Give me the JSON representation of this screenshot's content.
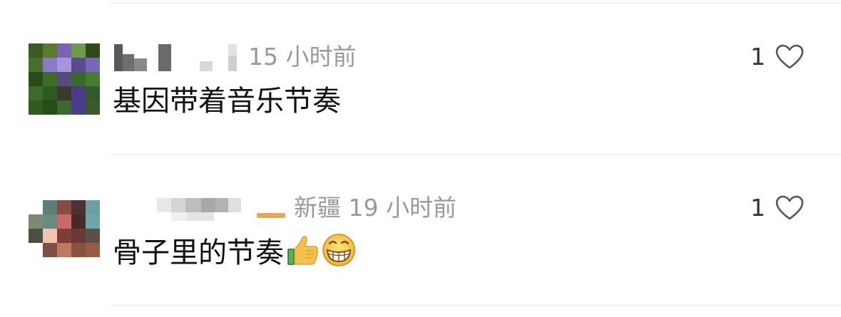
{
  "comments": [
    {
      "location": "",
      "time": "15 小时前",
      "text": "基因带着音乐节奏",
      "likes": "1",
      "avatar_colors": [
        "#3d5a1f",
        "#5a7a2c",
        "#7b62b5",
        "#6f9a4a",
        "#2f4a18",
        "#4b6f2a",
        "#8b79c9",
        "#a895dc",
        "#5c4a8f",
        "#7868b8",
        "#2a4a1a",
        "#3f6a28",
        "#5a4a7a",
        "#3a6a2a",
        "#4a7a34",
        "#3c6a2a",
        "#2e5a22",
        "#3a3a2a",
        "#4a3a8a",
        "#2f5a2a",
        "#2f5a20",
        "#2a4a18",
        "#3a6a30",
        "#4a3c8c",
        "#3a5a2a"
      ],
      "username_color": "#7a7a7a",
      "emojis": []
    },
    {
      "location": "新疆",
      "time": "19 小时前",
      "text": "骨子里的节奏",
      "likes": "1",
      "avatar_colors": [
        "#ffffff",
        "#5e7e7a",
        "#8a4a44",
        "#4a3430",
        "#6aa0a2",
        "#7a8a72",
        "#6a8a80",
        "#c86a6a",
        "#4a2a28",
        "#6aa8ac",
        "#4a5040",
        "#f0c4b0",
        "#7a4038",
        "#6a3a30",
        "#5a5048",
        "#ffffff",
        "#7a5048",
        "#c07a5a",
        "#8a5040",
        "#9a5a40",
        "#ffffff",
        "#ffffff",
        "#ffffff",
        "#ffffff",
        "#ffffff"
      ],
      "username_color": "#8a8a8a",
      "emojis": [
        "thumbs-up",
        "grinning-face"
      ]
    }
  ],
  "colors": {
    "meta_text": "#9a9a9a",
    "divider": "#e6e6e6",
    "heart_stroke": "#555555"
  }
}
